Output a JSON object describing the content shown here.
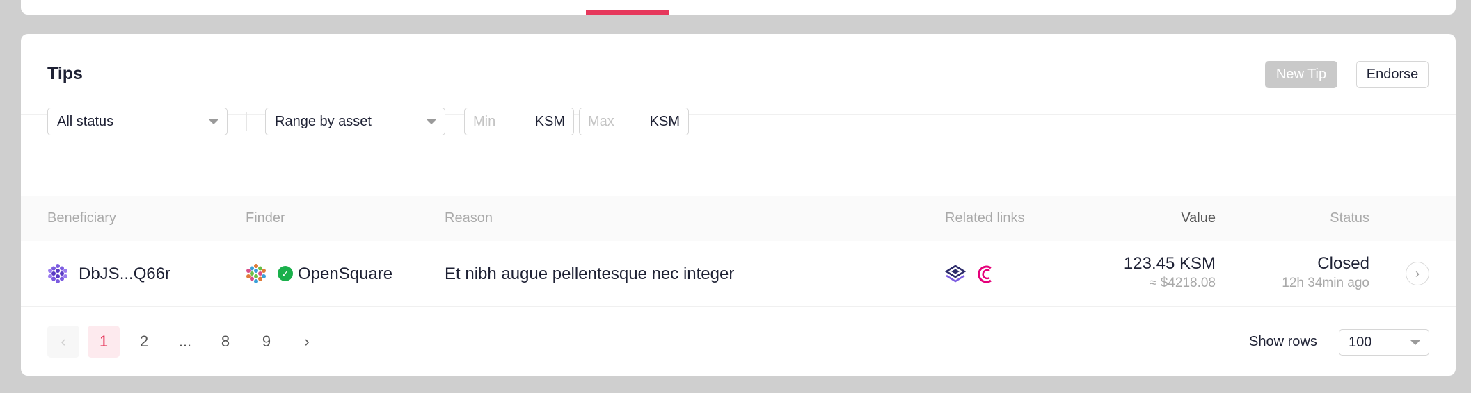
{
  "header": {
    "title": "Tips",
    "new_tip_label": "New Tip",
    "endorse_label": "Endorse"
  },
  "filters": {
    "status_select": "All status",
    "range_select": "Range by asset",
    "min": {
      "placeholder": "Min",
      "unit": "KSM"
    },
    "max": {
      "placeholder": "Max",
      "unit": "KSM"
    }
  },
  "table": {
    "columns": {
      "beneficiary": "Beneficiary",
      "finder": "Finder",
      "reason": "Reason",
      "related_links": "Related links",
      "value": "Value",
      "status": "Status"
    },
    "rows": [
      {
        "beneficiary": "DbJS...Q66r",
        "finder": "OpenSquare",
        "reason": "Et nibh augue pellentesque nec integer",
        "value": "123.45 KSM",
        "value_fiat": "≈ $4218.08",
        "status": "Closed",
        "time": "12h 34min ago"
      }
    ]
  },
  "pagination": {
    "prev": "‹",
    "pages": [
      "1",
      "2",
      "...",
      "8",
      "9"
    ],
    "next": "›",
    "show_rows_label": "Show rows",
    "rows_value": "100"
  },
  "colors": {
    "accent": "#e6385c",
    "verified": "#1ab04b"
  },
  "icons": {
    "beneficiary_identicon": "polkadot-identicon",
    "finder_identicon": "identicon",
    "verified": "check-circle-icon",
    "link_1": "subsquare-icon",
    "link_2": "polkassembly-icon",
    "row_arrow": "chevron-right-icon"
  }
}
